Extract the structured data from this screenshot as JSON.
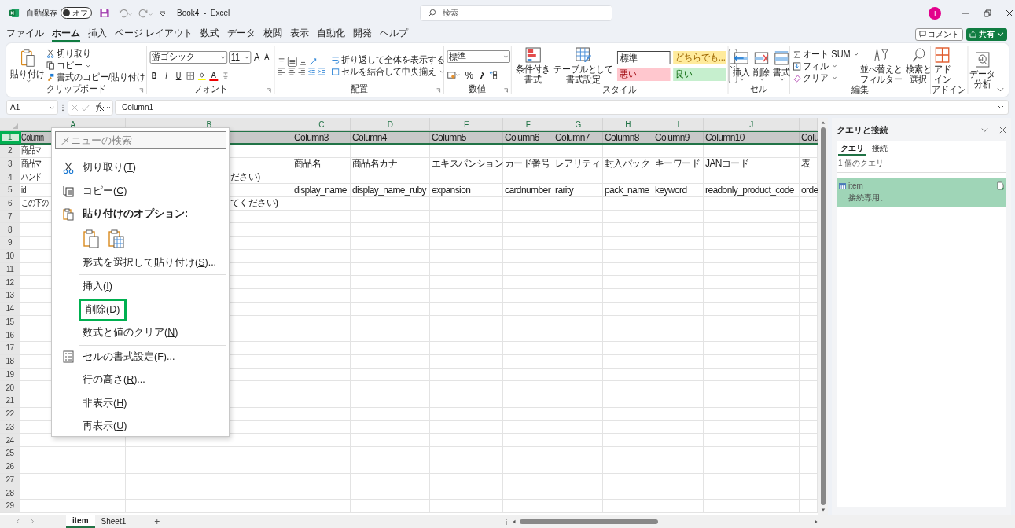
{
  "title_bar": {
    "autosave_label": "自動保存",
    "autosave_toggle": {
      "label": "オフ",
      "on": false
    },
    "document_title": "Book4  -  Excel",
    "search": {
      "placeholder": "検索"
    },
    "avatar": "I"
  },
  "menu_tabs": [
    {
      "label": "ファイル",
      "selected": false
    },
    {
      "label": "ホーム",
      "selected": true
    },
    {
      "label": "挿入",
      "selected": false
    },
    {
      "label": "ページ レイアウト",
      "selected": false
    },
    {
      "label": "数式",
      "selected": false
    },
    {
      "label": "データ",
      "selected": false
    },
    {
      "label": "校閲",
      "selected": false
    },
    {
      "label": "表示",
      "selected": false
    },
    {
      "label": "自動化",
      "selected": false
    },
    {
      "label": "開発",
      "selected": false
    },
    {
      "label": "ヘルプ",
      "selected": false
    }
  ],
  "comment_button": "コメント",
  "share_button": "共有",
  "ribbon": {
    "clipboard": {
      "paste": "貼り付け",
      "cut": "切り取り",
      "copy": "コピー",
      "format_painter": "書式のコピー/貼り付け",
      "group": "クリップボード"
    },
    "font": {
      "name": "游ゴシック",
      "size": "11",
      "grow": "A",
      "shrink": "A",
      "bold": "B",
      "italic": "I",
      "underline": "U",
      "font_color_label": "A",
      "group": "フォント"
    },
    "alignment": {
      "wrap": "折り返して全体を表示する",
      "merge": "セルを結合して中央揃え",
      "group": "配置"
    },
    "number": {
      "format": "標準",
      "percent": "%",
      "group": "数値"
    },
    "styles": {
      "conditional": [
        "条件付き",
        "書式"
      ],
      "table": [
        "テーブルとして",
        "書式設定"
      ],
      "cells": [
        {
          "label": "標準",
          "color": "#ffffff"
        },
        {
          "label": "どちらでも...",
          "color": "#ffeb9c"
        },
        {
          "label": "悪い",
          "color": "#ffc7ce"
        },
        {
          "label": "良い",
          "color": "#c6efce"
        }
      ],
      "group": "スタイル"
    },
    "cells": {
      "insert": "挿入",
      "delete": "削除",
      "format": "書式",
      "group": "セル"
    },
    "editing": {
      "autosum": "オート SUM",
      "fill": "フィル",
      "clear": "クリア",
      "sort": [
        "並べ替えと",
        "フィルター"
      ],
      "find": [
        "検索と",
        "選択"
      ],
      "group": "編集"
    },
    "addins": {
      "button": [
        "アド",
        "イン"
      ],
      "group": "アドイン"
    },
    "analysis": {
      "button": [
        "データ",
        "分析"
      ]
    }
  },
  "formula_bar": {
    "name_box": "A1",
    "formula": "Column1"
  },
  "grid": {
    "columns": [
      "A",
      "B",
      "C",
      "D",
      "E",
      "F",
      "G",
      "H",
      "I",
      "J"
    ],
    "rows": [
      {
        "number": "1",
        "selected": true,
        "kind": "header",
        "cells": [
          "Column",
          null,
          "Column3",
          "Column4",
          "Column5",
          "Column6",
          "Column7",
          "Column8",
          "Column9",
          "Column10",
          "Colu"
        ]
      },
      {
        "number": "2",
        "selected": false,
        "kind": "data",
        "cells": [
          "商品マ"
        ]
      },
      {
        "number": "3",
        "selected": false,
        "kind": "data",
        "cells": [
          "商品マ",
          null,
          "商品名",
          "商品名カナ",
          "エキスパンション",
          "カード番号",
          "レアリティ",
          "封入パック",
          "キーワード",
          "JANコード",
          "表"
        ]
      },
      {
        "number": "4",
        "selected": false,
        "kind": "data",
        "cells": [
          "ハンド",
          "ださい)"
        ]
      },
      {
        "number": "5",
        "selected": false,
        "kind": "data",
        "cells": [
          "id",
          null,
          "display_name",
          "display_name_ruby",
          "expansion",
          "cardnumber",
          "rarity",
          "pack_name",
          "keyword",
          "readonly_product_code",
          "orde"
        ]
      },
      {
        "number": "6",
        "selected": false,
        "kind": "data",
        "cells": [
          "この下の",
          "てください)"
        ]
      },
      {
        "number": "7",
        "selected": false,
        "kind": "data"
      },
      {
        "number": "8",
        "selected": false,
        "kind": "data"
      },
      {
        "number": "9",
        "selected": false,
        "kind": "data"
      },
      {
        "number": "10",
        "selected": false,
        "kind": "data"
      },
      {
        "number": "11",
        "selected": false,
        "kind": "data"
      },
      {
        "number": "12",
        "selected": false,
        "kind": "data"
      },
      {
        "number": "13",
        "selected": false,
        "kind": "data"
      },
      {
        "number": "14",
        "selected": false,
        "kind": "data"
      },
      {
        "number": "15",
        "selected": false,
        "kind": "data"
      },
      {
        "number": "16",
        "selected": false,
        "kind": "data"
      },
      {
        "number": "17",
        "selected": false,
        "kind": "data"
      },
      {
        "number": "18",
        "selected": false,
        "kind": "data"
      },
      {
        "number": "19",
        "selected": false,
        "kind": "data"
      },
      {
        "number": "20",
        "selected": false,
        "kind": "data"
      },
      {
        "number": "21",
        "selected": false,
        "kind": "data"
      },
      {
        "number": "22",
        "selected": false,
        "kind": "data"
      },
      {
        "number": "23",
        "selected": false,
        "kind": "data"
      },
      {
        "number": "24",
        "selected": false,
        "kind": "data"
      },
      {
        "number": "25",
        "selected": false,
        "kind": "data"
      },
      {
        "number": "26",
        "selected": false,
        "kind": "data"
      },
      {
        "number": "27",
        "selected": false,
        "kind": "data"
      },
      {
        "number": "28",
        "selected": false,
        "kind": "data"
      },
      {
        "number": "29",
        "selected": false,
        "kind": "data"
      }
    ]
  },
  "context_menu": {
    "search": {
      "placeholder": "メニューの検索"
    },
    "items": [
      {
        "kind": "item",
        "before": "切り取り(",
        "key": "T",
        "after": ")",
        "highlighted": false
      },
      {
        "kind": "item",
        "before": "コピー(",
        "key": "C",
        "after": ")",
        "highlighted": false
      },
      {
        "kind": "heading",
        "label": "貼り付けのオプション:"
      },
      {
        "kind": "paste_options"
      },
      {
        "kind": "item",
        "before": "形式を選択して貼り付け(",
        "key": "S",
        "after": ")...",
        "highlighted": false
      },
      {
        "kind": "separator"
      },
      {
        "kind": "item",
        "before": "挿入(",
        "key": "I",
        "after": ")",
        "highlighted": false
      },
      {
        "kind": "item",
        "before": "削除(",
        "key": "D",
        "after": ")",
        "highlighted": true
      },
      {
        "kind": "item",
        "before": "数式と値のクリア(",
        "key": "N",
        "after": ")",
        "highlighted": false
      },
      {
        "kind": "separator"
      },
      {
        "kind": "item",
        "before": "セルの書式設定(",
        "key": "F",
        "after": ")...",
        "highlighted": false
      },
      {
        "kind": "item",
        "before": "行の高さ(",
        "key": "R",
        "after": ")...",
        "highlighted": false
      },
      {
        "kind": "item",
        "before": "非表示(",
        "key": "H",
        "after": ")",
        "highlighted": false
      },
      {
        "kind": "item",
        "before": "再表示(",
        "key": "U",
        "after": ")",
        "highlighted": false
      }
    ]
  },
  "query_panel": {
    "title": "クエリと接続",
    "tabs": [
      {
        "label": "クエリ",
        "selected": true
      },
      {
        "label": "接続",
        "selected": false
      }
    ],
    "count": "1 個のクエリ",
    "queries": [
      {
        "name": "item",
        "description": "接続専用。",
        "selected": true
      }
    ]
  },
  "sheet_tabs": [
    {
      "label": "item",
      "selected": true
    },
    {
      "label": "Sheet1",
      "selected": false
    }
  ],
  "add_sheet": "+"
}
